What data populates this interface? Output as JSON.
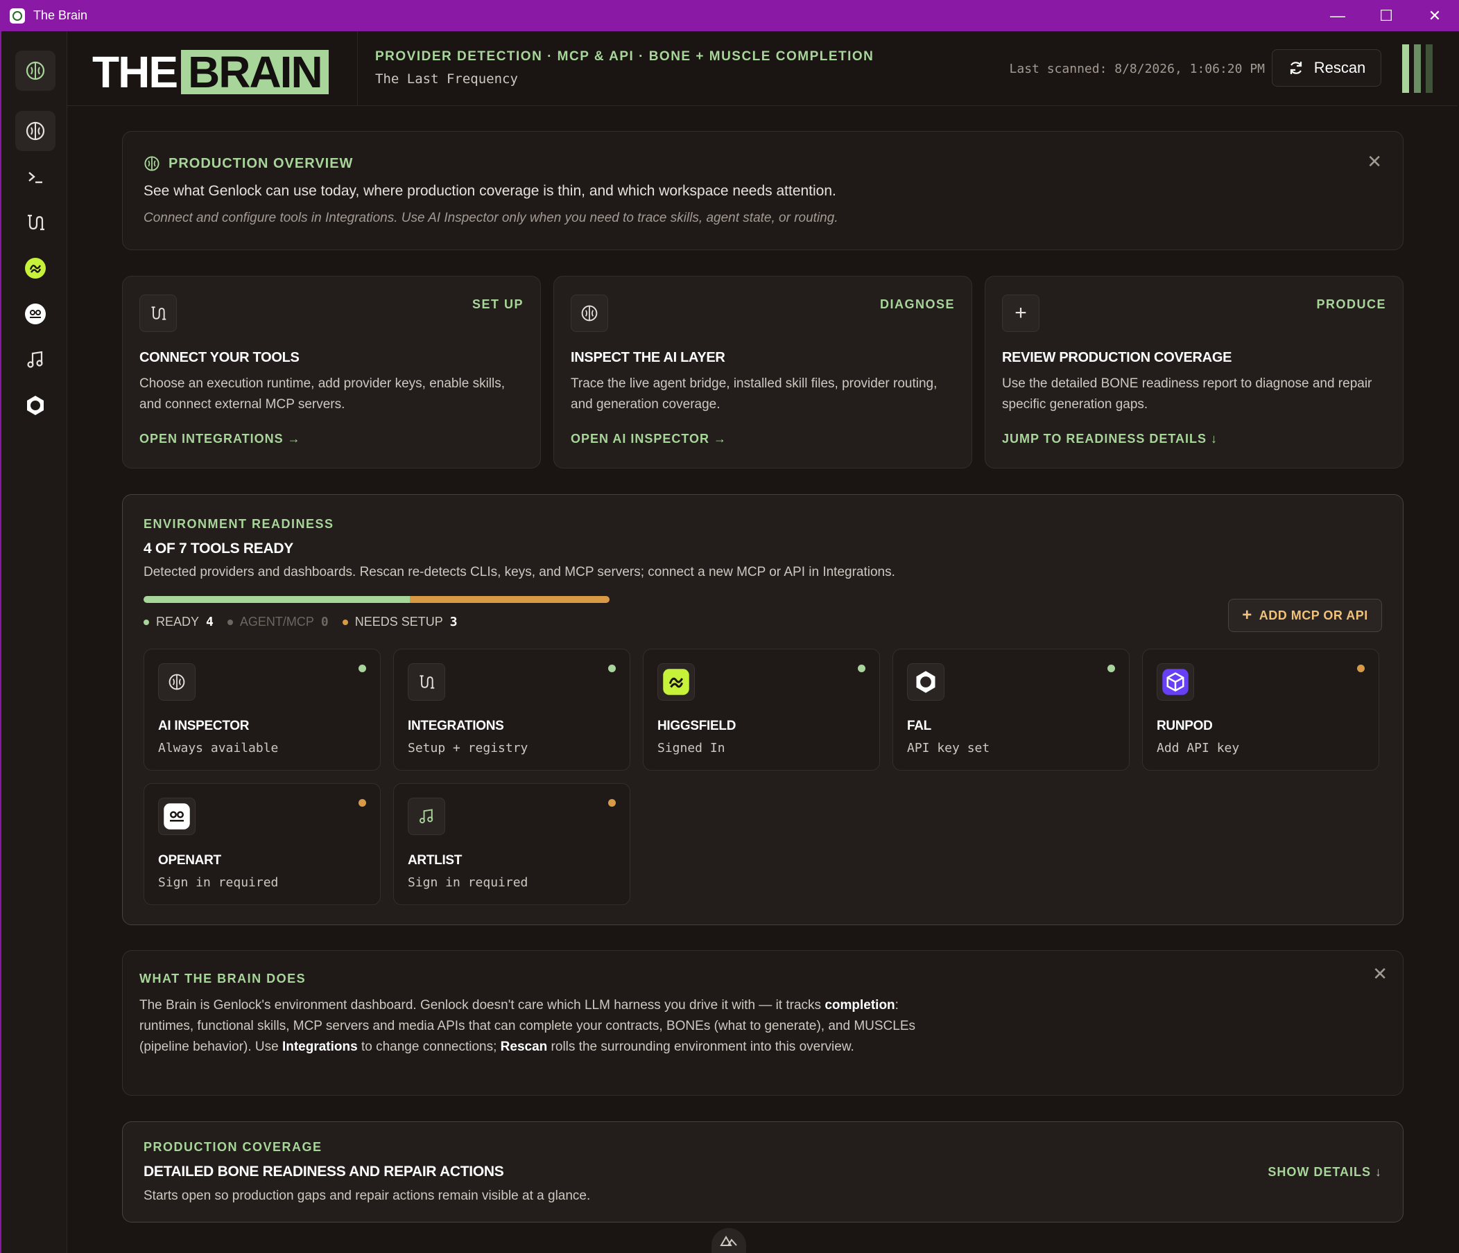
{
  "window": {
    "title": "The Brain",
    "controls": {
      "minimize": "—",
      "maximize": "☐",
      "close": "✕"
    }
  },
  "header": {
    "logo_the": "THE",
    "logo_brain": "BRAIN",
    "kicker": "PROVIDER DETECTION · MCP & API · BONE + MUSCLE COMPLETION",
    "subtitle": "The Last Frequency",
    "last_scanned": "Last scanned: 8/8/2026, 1:06:20 PM",
    "rescan_label": "Rescan"
  },
  "rail": {
    "items": [
      {
        "name": "brain-icon"
      },
      {
        "name": "brain-icon",
        "active": true
      },
      {
        "name": "terminal-icon"
      },
      {
        "name": "integrations-icon"
      },
      {
        "name": "higgsfield-icon"
      },
      {
        "name": "openart-icon"
      },
      {
        "name": "music-note-icon"
      },
      {
        "name": "fal-icon"
      }
    ]
  },
  "overview": {
    "title": "PRODUCTION OVERVIEW",
    "line1": "See what Genlock can use today, where production coverage is thin, and which workspace needs attention.",
    "line2": "Connect and configure tools in Integrations. Use AI Inspector only when you need to trace skills, agent state, or routing.",
    "close": "✕"
  },
  "cards": [
    {
      "tag": "SET UP",
      "title": "CONNECT YOUR TOOLS",
      "desc": "Choose an execution runtime, add provider keys, enable skills, and connect external MCP servers.",
      "link": "OPEN INTEGRATIONS →",
      "icon": "integrations-icon"
    },
    {
      "tag": "DIAGNOSE",
      "title": "INSPECT THE AI LAYER",
      "desc": "Trace the live agent bridge, installed skill files, provider routing, and generation coverage.",
      "link": "OPEN AI INSPECTOR →",
      "icon": "brain-icon"
    },
    {
      "tag": "PRODUCE",
      "title": "REVIEW PRODUCTION COVERAGE",
      "desc": "Use the detailed BONE readiness report to diagnose and repair specific generation gaps.",
      "link": "JUMP TO READINESS DETAILS ↓",
      "icon": "plus-icon",
      "icon_glyph": "+"
    }
  ],
  "environment": {
    "kicker": "ENVIRONMENT READINESS",
    "title": "4 OF 7 TOOLS READY",
    "desc": "Detected providers and dashboards. Rescan re-detects CLIs, keys, and MCP servers; connect a new MCP or API in Integrations.",
    "progress": {
      "ready": 4,
      "agent_mcp": 0,
      "needs_setup": 3,
      "total": 7
    },
    "legend": {
      "ready_label": "READY",
      "ready_count": "4",
      "agent_label": "AGENT/MCP",
      "agent_count": "0",
      "setup_label": "NEEDS SETUP",
      "setup_count": "3"
    },
    "add_button": "ADD MCP OR API",
    "add_glyph": "+",
    "colors": {
      "ready": "#a8d69a",
      "needs_setup": "#d99a45",
      "agent": "#6e6660"
    },
    "tools": [
      {
        "name": "AI INSPECTOR",
        "status": "Always available",
        "state": "ready",
        "icon": "brain-icon"
      },
      {
        "name": "INTEGRATIONS",
        "status": "Setup + registry",
        "state": "ready",
        "icon": "integrations-icon"
      },
      {
        "name": "HIGGSFIELD",
        "status": "Signed In",
        "state": "ready",
        "icon": "higgsfield-icon"
      },
      {
        "name": "FAL",
        "status": "API key set",
        "state": "ready",
        "icon": "fal-icon"
      },
      {
        "name": "RUNPOD",
        "status": "Add API key",
        "state": "needs_setup",
        "icon": "runpod-icon"
      },
      {
        "name": "OPENART",
        "status": "Sign in required",
        "state": "needs_setup",
        "icon": "openart-icon"
      },
      {
        "name": "ARTLIST",
        "status": "Sign in required",
        "state": "needs_setup",
        "icon": "music-note-icon"
      }
    ]
  },
  "does": {
    "kicker": "WHAT THE BRAIN DOES",
    "p1": "The Brain is Genlock's environment dashboard. Genlock doesn't care which LLM harness you drive it with — it tracks ",
    "b1": "completion",
    "p2": ": runtimes, functional skills, MCP servers and media APIs that can complete your contracts, BONEs (what to generate), and MUSCLEs (pipeline behavior). Use ",
    "b2": "Integrations",
    "p3": " to change connections; ",
    "b3": "Rescan",
    "p4": " rolls the surrounding environment into this overview.",
    "close": "✕"
  },
  "coverage": {
    "kicker": "PRODUCTION COVERAGE",
    "title": "DETAILED BONE READINESS AND REPAIR ACTIONS",
    "desc": "Starts open so production gaps and repair actions remain visible at a glance.",
    "link": "SHOW DETAILS ↓"
  }
}
